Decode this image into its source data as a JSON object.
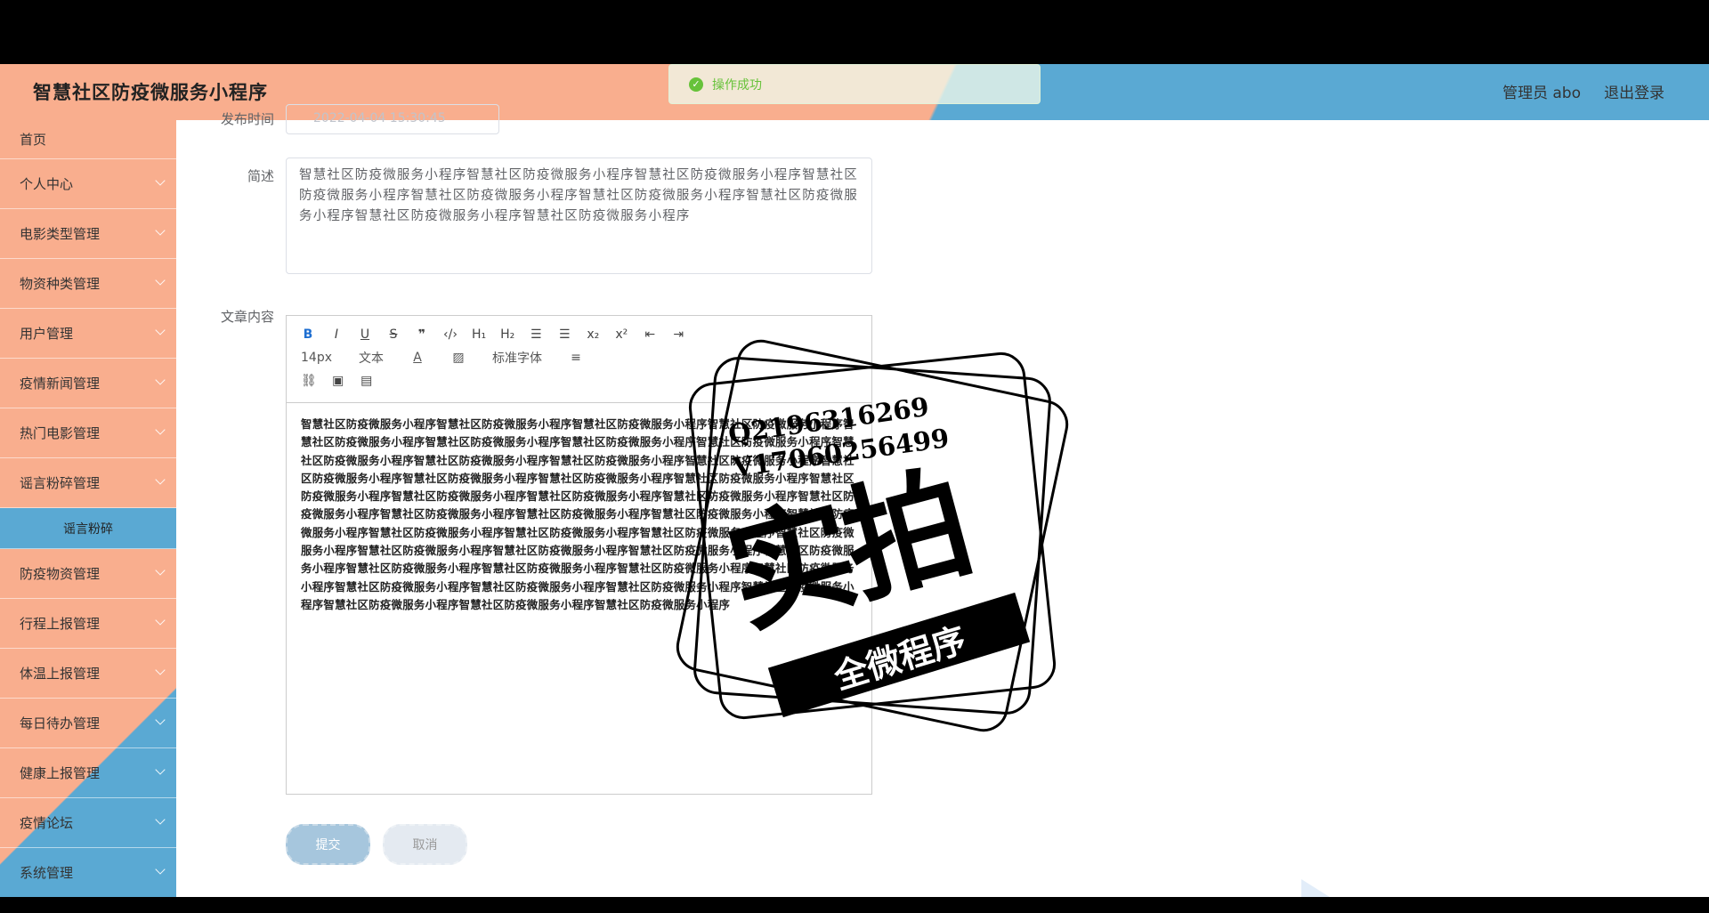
{
  "header": {
    "title": "智慧社区防疫微服务小程序",
    "user_label": "管理员 abo",
    "logout_label": "退出登录"
  },
  "toast": {
    "message": "操作成功"
  },
  "sidebar": {
    "items": [
      {
        "label": "首页"
      },
      {
        "label": "个人中心"
      },
      {
        "label": "电影类型管理"
      },
      {
        "label": "物资种类管理"
      },
      {
        "label": "用户管理"
      },
      {
        "label": "疫情新闻管理"
      },
      {
        "label": "热门电影管理"
      },
      {
        "label": "谣言粉碎管理"
      },
      {
        "label": "谣言粉碎"
      },
      {
        "label": "防疫物资管理"
      },
      {
        "label": "行程上报管理"
      },
      {
        "label": "体温上报管理"
      },
      {
        "label": "每日待办管理"
      },
      {
        "label": "健康上报管理"
      },
      {
        "label": "疫情论坛"
      },
      {
        "label": "系统管理"
      }
    ]
  },
  "form": {
    "date_label": "发布时间",
    "date_value": "2022-04-04 15:30:45",
    "summary_label": "简述",
    "summary_value": "智慧社区防疫微服务小程序智慧社区防疫微服务小程序智慧社区防疫微服务小程序智慧社区防疫微服务小程序智慧社区防疫微服务小程序智慧社区防疫微服务小程序智慧社区防疫微服务小程序智慧社区防疫微服务小程序智慧社区防疫微服务小程序",
    "content_label": "文章内容",
    "content_value": "智慧社区防疫微服务小程序智慧社区防疫微服务小程序智慧社区防疫微服务小程序智慧社区防疫微服务小程序智慧社区防疫微服务小程序智慧社区防疫微服务小程序智慧社区防疫微服务小程序智慧社区防疫微服务小程序智慧社区防疫微服务小程序智慧社区防疫微服务小程序智慧社区防疫微服务小程序智慧社区防疫微服务小程序智慧社区防疫微服务小程序智慧社区防疫微服务小程序智慧社区防疫微服务小程序智慧社区防疫微服务小程序智慧社区防疫微服务小程序智慧社区防疫微服务小程序智慧社区防疫微服务小程序智慧社区防疫微服务小程序智慧社区防疫微服务小程序智慧社区防疫微服务小程序智慧社区防疫微服务小程序智慧社区防疫微服务小程序智慧社区防疫微服务小程序智慧社区防疫微服务小程序智慧社区防疫微服务小程序智慧社区防疫微服务小程序智慧社区防疫微服务小程序智慧社区防疫微服务小程序智慧社区防疫微服务小程序智慧社区防疫微服务小程序智慧社区防疫微服务小程序智慧社区防疫微服务小程序智慧社区防疫微服务小程序智慧社区防疫微服务小程序智慧社区防疫微服务小程序智慧社区防疫微服务小程序智慧社区防疫微服务小程序智慧社区防疫微服务小程序智慧社区防疫微服务小程序智慧社区防疫微服务小程序智慧社区防疫微服务小程序智慧社区防疫微服务小程序",
    "submit_label": "提交",
    "cancel_label": "取消"
  },
  "editor_toolbar": {
    "font_size": "14px",
    "paragraph": "文本",
    "font_family": "标准字体"
  },
  "watermark": {
    "line1": "Q2196316269",
    "line2": "V17060256499",
    "big": "实拍",
    "ribbon": "全微程序"
  }
}
